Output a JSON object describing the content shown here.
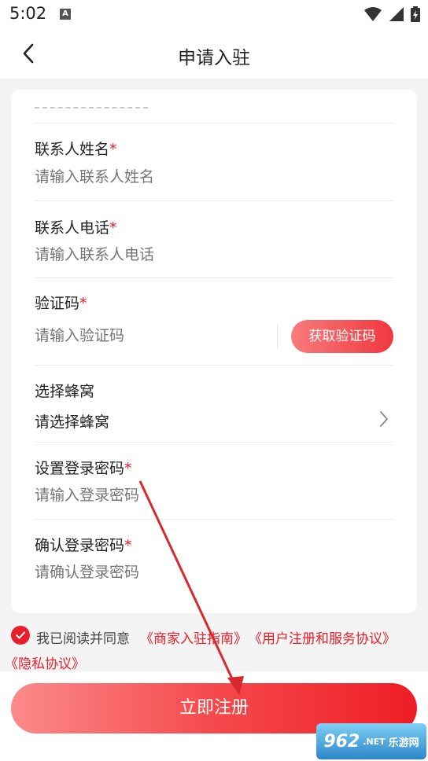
{
  "status_bar": {
    "time": "5:02",
    "badge": "A"
  },
  "header": {
    "title": "申请入驻"
  },
  "form": {
    "contact_name": {
      "label": "联系人姓名",
      "required_mark": "*",
      "placeholder": "请输入联系人姓名"
    },
    "contact_phone": {
      "label": "联系人电话",
      "required_mark": "*",
      "placeholder": "请输入联系人电话"
    },
    "verify_code": {
      "label": "验证码",
      "required_mark": "*",
      "placeholder": "请输入验证码",
      "button": "获取验证码"
    },
    "hive": {
      "label": "选择蜂窝",
      "value": "请选择蜂窝"
    },
    "password": {
      "label": "设置登录密码",
      "required_mark": "*",
      "placeholder": "请输入登录密码"
    },
    "confirm_password": {
      "label": "确认登录密码",
      "required_mark": "*",
      "placeholder": "请确认登录密码"
    }
  },
  "agreement": {
    "checked": true,
    "text": "我已阅读并同意",
    "link_guide": "《商家入驻指南》",
    "link_terms": "《用户注册和服务协议》",
    "link_privacy": "《隐私协议》"
  },
  "submit": {
    "label": "立即注册"
  },
  "watermark": {
    "number": "962",
    "net": ".NET",
    "site": "乐游网"
  },
  "colors": {
    "accent": "#e8202a",
    "background": "#f4f4f4",
    "placeholder": "#aaaaaa"
  }
}
